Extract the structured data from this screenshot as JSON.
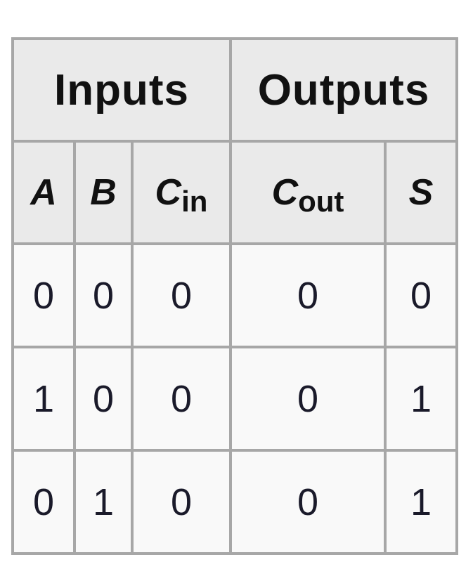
{
  "table": {
    "groups": {
      "inputs": "Inputs",
      "outputs": "Outputs"
    },
    "columns": {
      "a": "A",
      "b": "B",
      "cin_main": "C",
      "cin_sub": "in",
      "cout_main": "C",
      "cout_sub": "out",
      "s": "S"
    },
    "rows": [
      [
        "0",
        "0",
        "0",
        "0",
        "0"
      ],
      [
        "1",
        "0",
        "0",
        "0",
        "1"
      ],
      [
        "0",
        "1",
        "0",
        "0",
        "1"
      ]
    ]
  }
}
